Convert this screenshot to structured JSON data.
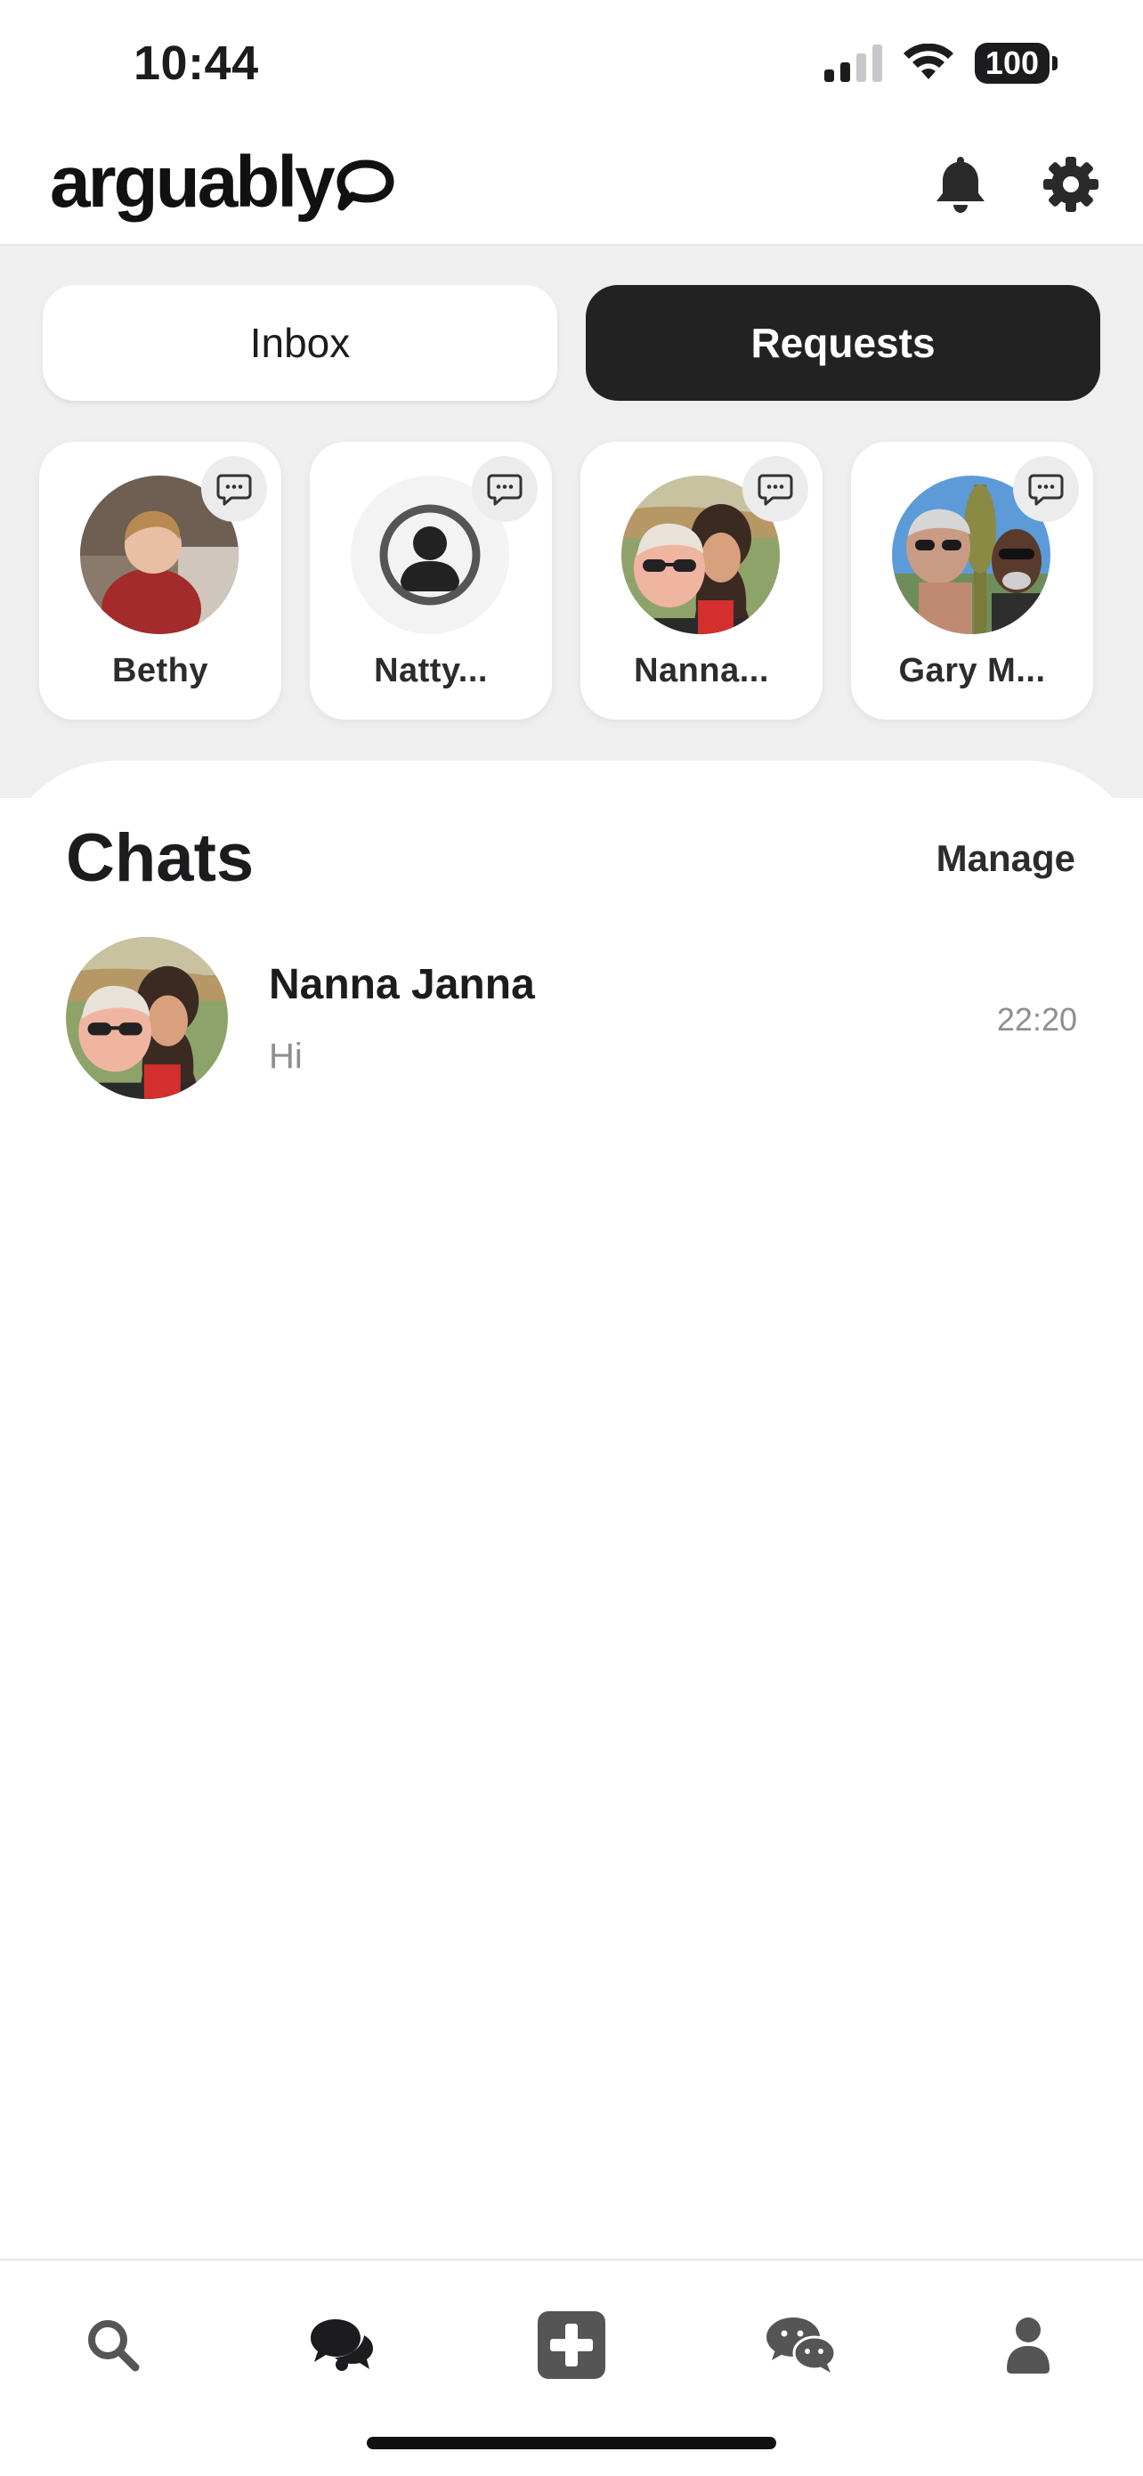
{
  "status_bar": {
    "time": "10:44",
    "battery": "100"
  },
  "header": {
    "brand": "arguably"
  },
  "segments": {
    "inbox": "Inbox",
    "requests": "Requests",
    "active": "requests"
  },
  "requests": [
    {
      "name": "Bethy"
    },
    {
      "name": "Natty..."
    },
    {
      "name": "Nanna..."
    },
    {
      "name": "Gary M..."
    }
  ],
  "chats": {
    "title": "Chats",
    "manage": "Manage",
    "items": [
      {
        "name": "Nanna Janna",
        "message": "Hi",
        "time": "22:20"
      }
    ]
  },
  "tab_bar": {
    "items": [
      {
        "icon": "search-icon"
      },
      {
        "icon": "chats-icon",
        "active": true
      },
      {
        "icon": "add-post-icon"
      },
      {
        "icon": "messages-icon"
      },
      {
        "icon": "profile-icon"
      }
    ]
  },
  "colors": {
    "dark": "#222222",
    "background_grey": "#efefef",
    "muted": "#8e8e93"
  }
}
